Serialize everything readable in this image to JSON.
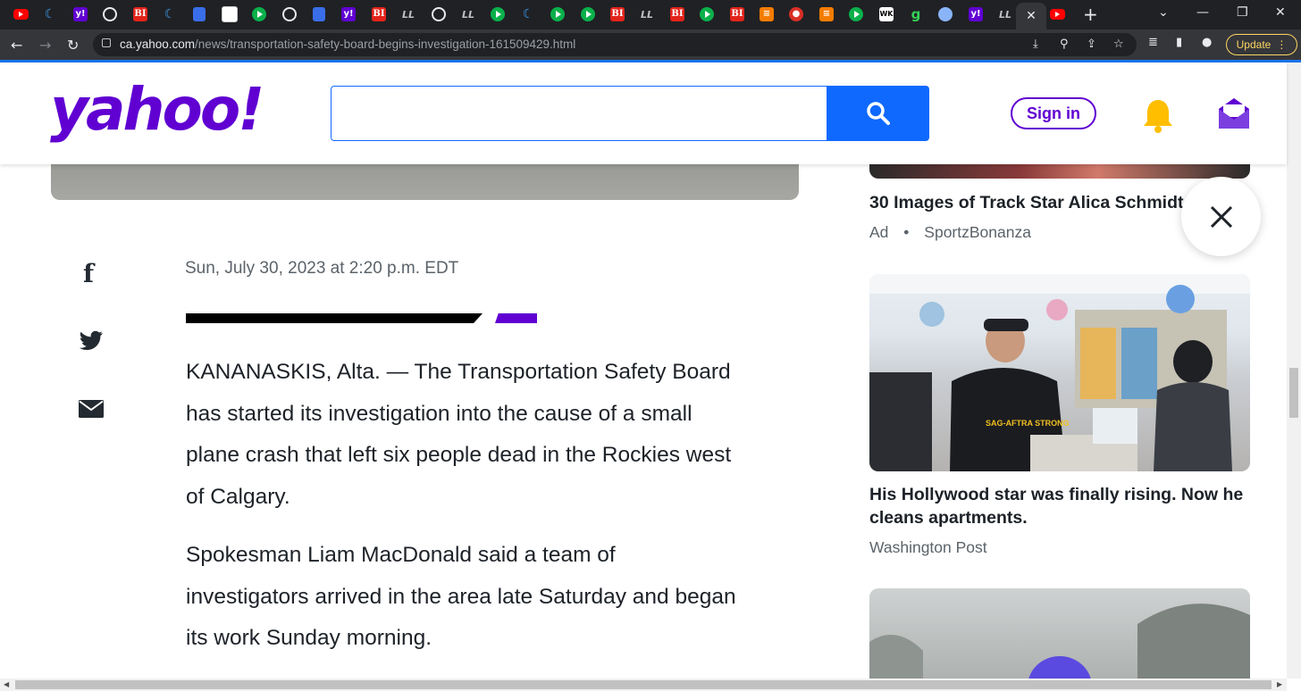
{
  "browser": {
    "tabs": [
      {
        "icon": "youtube-icon",
        "kind": "yt",
        "text": ""
      },
      {
        "icon": "moon-icon",
        "kind": "moon",
        "text": "☾"
      },
      {
        "icon": "yahoo-icon",
        "kind": "ya",
        "text": "y!"
      },
      {
        "icon": "globe-icon",
        "kind": "globe",
        "text": ""
      },
      {
        "icon": "business-insider-icon",
        "kind": "bi",
        "text": "BI"
      },
      {
        "icon": "moon-icon",
        "kind": "moon",
        "text": "☾"
      },
      {
        "icon": "doc-icon",
        "kind": "doc",
        "text": ""
      },
      {
        "icon": "sheet-icon",
        "kind": "sheet",
        "text": ""
      },
      {
        "icon": "play-icon",
        "kind": "gr",
        "text": ""
      },
      {
        "icon": "globe-icon",
        "kind": "globe",
        "text": ""
      },
      {
        "icon": "doc-icon",
        "kind": "doc",
        "text": ""
      },
      {
        "icon": "yahoo-icon",
        "kind": "ya",
        "text": "y!"
      },
      {
        "icon": "business-insider-icon",
        "kind": "bi",
        "text": "BI"
      },
      {
        "icon": "slash-icon",
        "kind": "dash",
        "text": "LL"
      },
      {
        "icon": "globe-icon",
        "kind": "globe",
        "text": ""
      },
      {
        "icon": "slash-icon",
        "kind": "dash",
        "text": "LL"
      },
      {
        "icon": "play-icon",
        "kind": "gr",
        "text": ""
      },
      {
        "icon": "moon-icon",
        "kind": "moon",
        "text": "☾"
      },
      {
        "icon": "play-icon",
        "kind": "gr",
        "text": ""
      },
      {
        "icon": "play-icon",
        "kind": "gr",
        "text": ""
      },
      {
        "icon": "business-insider-icon",
        "kind": "bi",
        "text": "BI"
      },
      {
        "icon": "slash-icon",
        "kind": "dash",
        "text": "LL"
      },
      {
        "icon": "business-insider-icon",
        "kind": "bi",
        "text": "BI"
      },
      {
        "icon": "play-icon",
        "kind": "gr",
        "text": ""
      },
      {
        "icon": "business-insider-icon",
        "kind": "bi",
        "text": "BI"
      },
      {
        "icon": "stack-icon",
        "kind": "orange",
        "text": "≡"
      },
      {
        "icon": "mic-icon",
        "kind": "mic",
        "text": "●"
      },
      {
        "icon": "stack-icon",
        "kind": "orange",
        "text": "≡"
      },
      {
        "icon": "play-icon",
        "kind": "gr",
        "text": ""
      },
      {
        "icon": "wk-icon",
        "kind": "wk",
        "text": "WK"
      },
      {
        "icon": "g-icon",
        "kind": "g",
        "text": "g"
      },
      {
        "icon": "avatar-icon",
        "kind": "av",
        "text": ""
      },
      {
        "icon": "yahoo-icon",
        "kind": "ya",
        "text": "y!"
      },
      {
        "icon": "slash-icon",
        "kind": "dash",
        "text": "LL"
      }
    ],
    "active_tab_close": "✕",
    "after_tab": {
      "icon": "youtube-icon"
    },
    "new_tab_label": "+",
    "url_host": "ca.yahoo.com",
    "url_path": "/news/transportation-safety-board-begins-investigation-161509429.html",
    "update_label": "Update",
    "update_menu": "⋮"
  },
  "header": {
    "logo": "yahoo!",
    "search": {
      "placeholder": "",
      "value": ""
    },
    "signin_label": "Sign in"
  },
  "article": {
    "dateline": "Sun, July 30, 2023 at 2:20 p.m. EDT",
    "paragraphs": [
      "KANANASKIS, Alta. — The Transportation Safety Board has started its investigation into the cause of a small plane crash that left six people dead in the Rockies west of Calgary.",
      "Spokesman Liam MacDonald said a team of investigators arrived in the area late Saturday and began its work Sunday morning."
    ]
  },
  "sidebar": {
    "item1": {
      "title": "30 Images of Track Star Alica Schmidt",
      "ad_label": "Ad",
      "separator": "•",
      "source": "SportzBonanza"
    },
    "item2": {
      "title": "His Hollywood star was finally rising. Now he cleans apartments.",
      "source": "Washington Post",
      "shirt_text": "SAG-AFTRA STRONG"
    }
  },
  "colors": {
    "yahoo_purple": "#6001d2",
    "search_blue": "#0f69ff",
    "bell_yellow": "#ffbe00"
  }
}
